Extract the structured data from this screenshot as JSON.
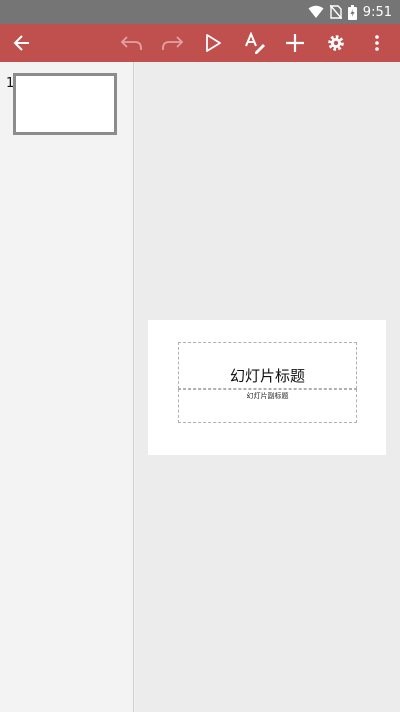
{
  "status_bar": {
    "time": "9:51",
    "icons": [
      "wifi-icon",
      "no-sim-icon",
      "battery-charging-icon"
    ]
  },
  "toolbar": {
    "accent_color": "#c0504d",
    "buttons": [
      "back-arrow-icon",
      "undo-icon",
      "redo-icon",
      "play-icon",
      "text-format-icon",
      "add-icon",
      "settings-gear-icon",
      "more-vert-icon"
    ]
  },
  "slides_panel": {
    "items": [
      {
        "number": "1"
      }
    ]
  },
  "slide": {
    "title_placeholder": "幻灯片标题",
    "subtitle_placeholder": "幻灯片副标题"
  }
}
